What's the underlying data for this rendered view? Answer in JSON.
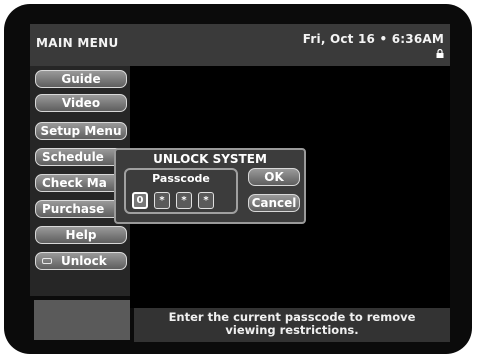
{
  "header": {
    "title": "MAIN MENU",
    "datetime": "Fri, Oct 16 • 6:36AM",
    "lock_icon": "lock-icon"
  },
  "sidebar": {
    "items": [
      {
        "label": "Guide"
      },
      {
        "label": "Video"
      },
      {
        "label": "Setup Menu"
      },
      {
        "label": "Schedule"
      },
      {
        "label": "Check Ma"
      },
      {
        "label": "Purchase"
      },
      {
        "label": "Help"
      },
      {
        "label": "Unlock",
        "icon": "unlock-icon"
      }
    ]
  },
  "dialog": {
    "title": "UNLOCK SYSTEM",
    "passcode_label": "Passcode",
    "digits": [
      "0",
      "*",
      "*",
      "*"
    ],
    "ok_label": "OK",
    "cancel_label": "Cancel"
  },
  "footer": {
    "message_line1": "Enter the current passcode to remove",
    "message_line2": "viewing restrictions."
  },
  "colors": {
    "background": "#0b0b0b",
    "header_bar": "#3a3a3a",
    "button_top": "#9a9a9a",
    "button_bottom": "#5e5e5e",
    "text": "#ffffff"
  }
}
